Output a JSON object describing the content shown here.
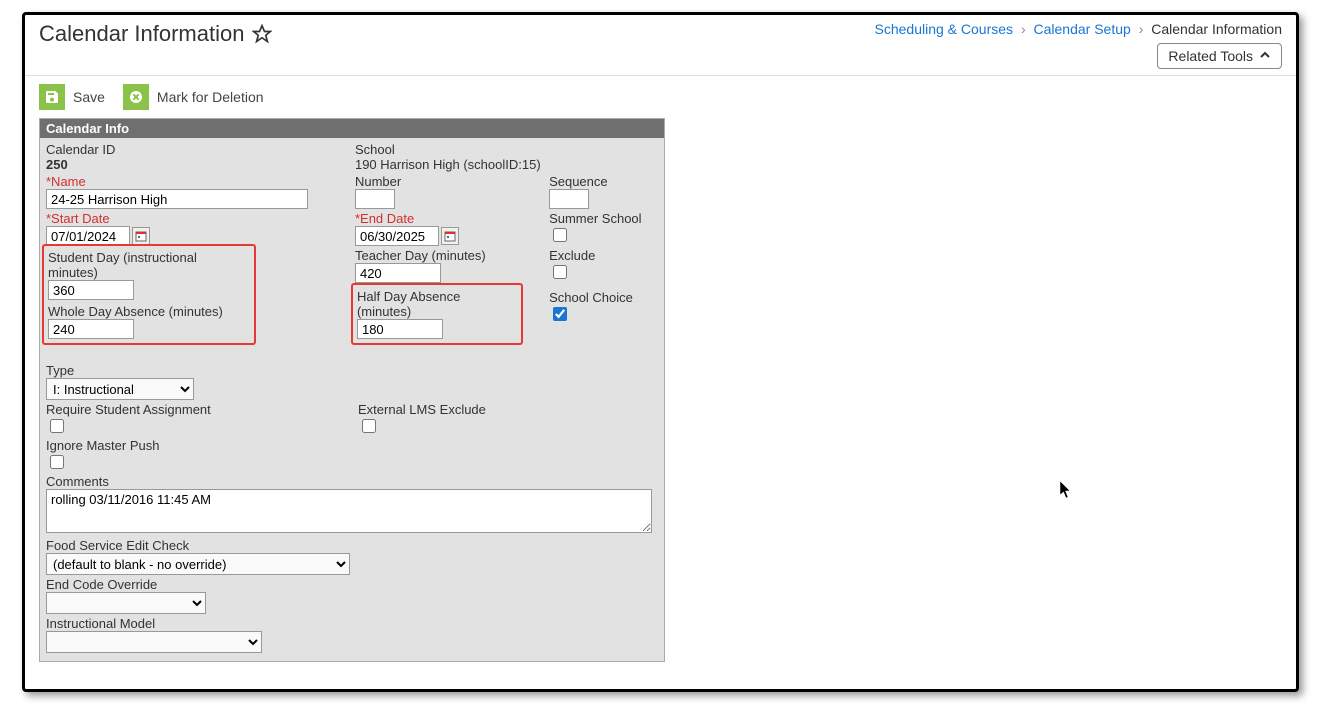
{
  "header": {
    "title": "Calendar Information",
    "breadcrumb": {
      "item1": "Scheduling & Courses",
      "item2": "Calendar Setup",
      "item3": "Calendar Information"
    },
    "related_tools": "Related Tools"
  },
  "toolbar": {
    "save": "Save",
    "mark_delete": "Mark for Deletion"
  },
  "panel": {
    "header": "Calendar Info",
    "labels": {
      "calendar_id": "Calendar ID",
      "school": "School",
      "name": "*Name",
      "number": "Number",
      "sequence": "Sequence",
      "start_date": "*Start Date",
      "end_date": "*End Date",
      "summer_school": "Summer School",
      "student_day": "Student Day (instructional minutes)",
      "teacher_day": "Teacher Day (minutes)",
      "exclude": "Exclude",
      "whole_day_absence": "Whole Day Absence (minutes)",
      "half_day_absence": "Half Day Absence (minutes)",
      "school_choice": "School Choice",
      "type": "Type",
      "require_student_assignment": "Require Student Assignment",
      "external_lms_exclude": "External LMS Exclude",
      "ignore_master_push": "Ignore Master Push",
      "comments": "Comments",
      "food_service_edit_check": "Food Service Edit Check",
      "end_code_override": "End Code Override",
      "instructional_model": "Instructional Model"
    },
    "values": {
      "calendar_id": "250",
      "school": "190 Harrison High (schoolID:15)",
      "name": "24-25 Harrison High",
      "number": "",
      "sequence": "",
      "start_date": "07/01/2024",
      "end_date": "06/30/2025",
      "summer_school": false,
      "student_day": "360",
      "teacher_day": "420",
      "exclude": false,
      "whole_day_absence": "240",
      "half_day_absence": "180",
      "school_choice": true,
      "type": "I: Instructional",
      "require_student_assignment": false,
      "external_lms_exclude": false,
      "ignore_master_push": false,
      "comments": "rolling 03/11/2016 11:45 AM",
      "food_service_edit_check": "(default to blank - no override)",
      "end_code_override": "",
      "instructional_model": ""
    }
  }
}
